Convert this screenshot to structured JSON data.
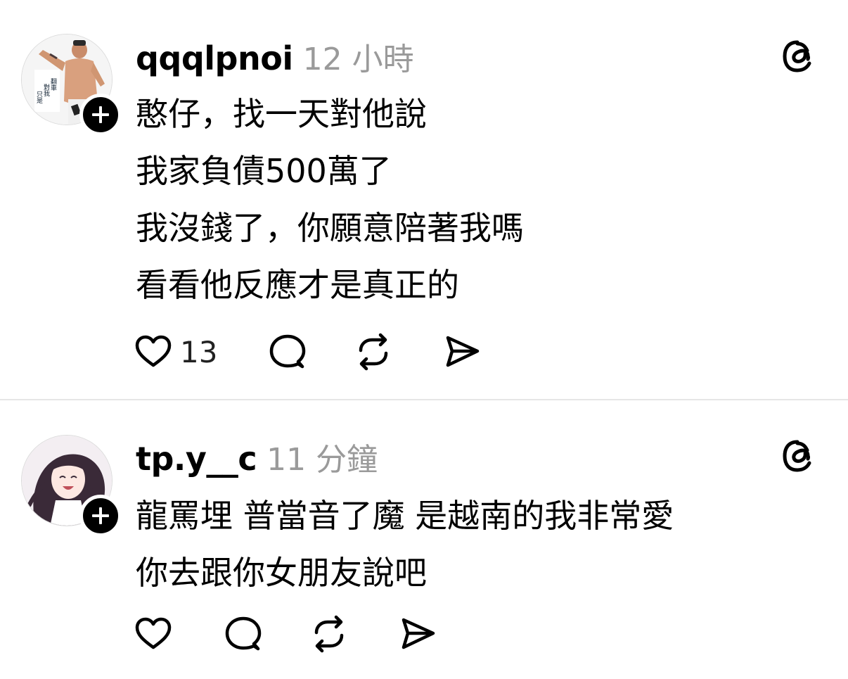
{
  "posts": [
    {
      "username": "qqqlpnoi",
      "timestamp": "12 小時",
      "lines": [
        "憨仔，找一天對他說",
        "我家負債500萬了",
        "我沒錢了，你願意陪著我嗎",
        "看看他反應才是真正的"
      ],
      "likes": "13",
      "avatar_text": "翻車魚 對我不真 只是一起嗎",
      "icons": [
        "heart-icon",
        "comment-icon",
        "repost-icon",
        "share-icon",
        "threads-logo-icon",
        "plus-icon"
      ]
    },
    {
      "username": "tp.y__c",
      "timestamp": "11 分鐘",
      "lines": [
        "龍罵埋 普當音了魔 是越南的我非常愛",
        "你去跟你女朋友說吧"
      ],
      "likes": "",
      "icons": [
        "heart-icon",
        "comment-icon",
        "repost-icon",
        "share-icon",
        "threads-logo-icon",
        "plus-icon"
      ]
    }
  ],
  "colors": {
    "text": "#000000",
    "timestamp": "#9a9a9a",
    "divider": "#e6e6e6",
    "badge": "#000000"
  }
}
